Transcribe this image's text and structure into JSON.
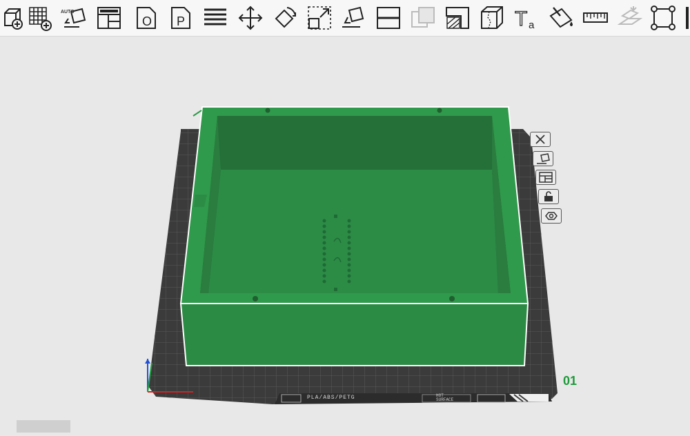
{
  "toolbar": {
    "tools": [
      {
        "name": "add-object",
        "icon": "cube-plus-icon"
      },
      {
        "name": "add-plate",
        "icon": "grid-plus-icon"
      },
      {
        "name": "auto-orient",
        "icon": "auto-orient-icon",
        "label": "AUTO"
      },
      {
        "name": "arrange",
        "icon": "arrange-icon"
      },
      {
        "name": "object-mode",
        "icon": "object-o-icon",
        "label": "O"
      },
      {
        "name": "plate-mode",
        "icon": "plate-p-icon",
        "label": "P"
      },
      {
        "name": "layers",
        "icon": "layers-icon"
      },
      {
        "name": "move",
        "icon": "move-icon"
      },
      {
        "name": "rotate",
        "icon": "rotate-icon"
      },
      {
        "name": "scale",
        "icon": "scale-icon"
      },
      {
        "name": "lay-on-face",
        "icon": "lay-on-face-icon"
      },
      {
        "name": "cut",
        "icon": "cut-icon"
      },
      {
        "name": "boolean",
        "icon": "boolean-icon"
      },
      {
        "name": "support-paint",
        "icon": "support-paint-icon"
      },
      {
        "name": "seam-paint",
        "icon": "seam-paint-icon"
      },
      {
        "name": "text",
        "icon": "text-icon",
        "label": "T",
        "sublabel": "a"
      },
      {
        "name": "color-paint",
        "icon": "paint-bucket-icon"
      },
      {
        "name": "measure",
        "icon": "ruler-icon"
      },
      {
        "name": "assembly",
        "icon": "assembly-icon"
      },
      {
        "name": "fit-view",
        "icon": "frame-icon"
      }
    ]
  },
  "side_tools": [
    {
      "name": "delete",
      "icon": "close-icon"
    },
    {
      "name": "orient",
      "icon": "orient-icon"
    },
    {
      "name": "arrange",
      "icon": "arrange-icon"
    },
    {
      "name": "lock",
      "icon": "unlock-icon"
    },
    {
      "name": "settings",
      "icon": "gear-icon"
    }
  ],
  "plate": {
    "number": "01",
    "filament_label": "PLA/ABS/PETG",
    "surface_label_1": "HOT",
    "surface_label_2": "SURFACE"
  },
  "colors": {
    "model_green": "#2f9a4b",
    "model_dark": "#226f35",
    "plate": "#3b3b3b",
    "accent": "#1f9a3c"
  }
}
